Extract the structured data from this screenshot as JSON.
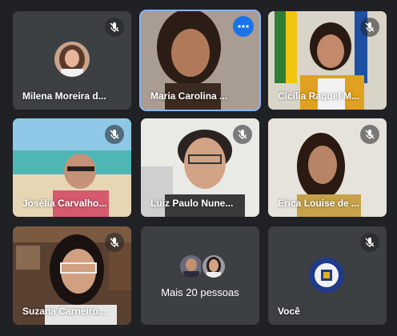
{
  "participants": [
    {
      "name": "Milena Moreira d...",
      "muted": true
    },
    {
      "name": "Maria Carolina ...",
      "muted": false,
      "active_speaker": true
    },
    {
      "name": "Cicília Raquel M...",
      "muted": true
    },
    {
      "name": "Josélia Carvalho...",
      "muted": true
    },
    {
      "name": "Luiz Paulo Nune...",
      "muted": true
    },
    {
      "name": "Érica Louise de ...",
      "muted": true
    },
    {
      "name": "Suzana Carneiro...",
      "muted": true
    }
  ],
  "overflow_tile": {
    "label": "Mais 20 pessoas"
  },
  "self_tile": {
    "name": "Você",
    "muted": true
  },
  "colors": {
    "background": "#202124",
    "tile": "#3c4043",
    "active_outline": "#8ab4f8",
    "more_button": "#1a73e8"
  }
}
